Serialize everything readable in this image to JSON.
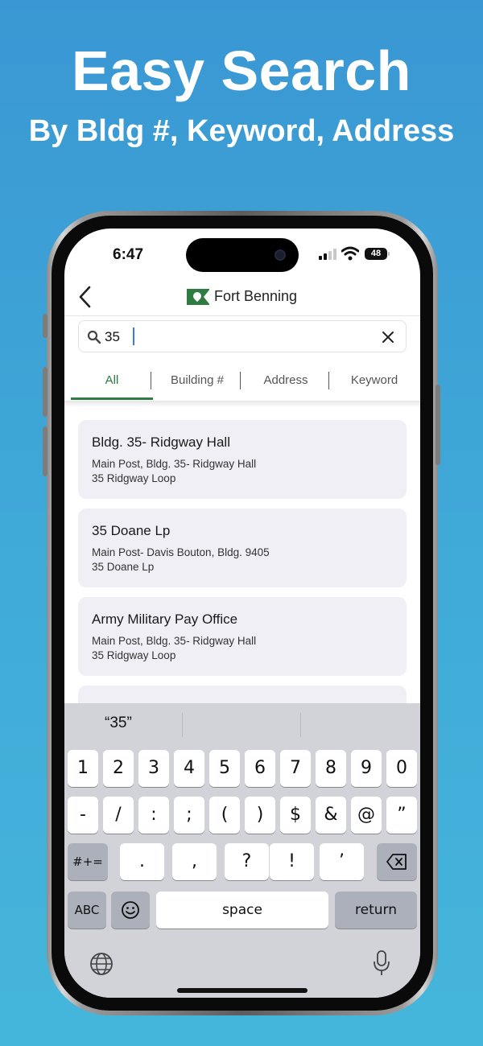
{
  "headline": {
    "title": "Easy Search",
    "subtitle": "By Bldg #, Keyword, Address"
  },
  "status_bar": {
    "time": "6:47",
    "battery": "48"
  },
  "nav": {
    "title": "Fort Benning"
  },
  "search": {
    "value": "35"
  },
  "tabs": [
    {
      "label": "All",
      "active": true
    },
    {
      "label": "Building #",
      "active": false
    },
    {
      "label": "Address",
      "active": false
    },
    {
      "label": "Keyword",
      "active": false
    }
  ],
  "results": [
    {
      "title": "Bldg. 35- Ridgway Hall",
      "line1": "Main Post, Bldg. 35- Ridgway Hall",
      "line2": "35 Ridgway Loop"
    },
    {
      "title": "35 Doane Lp",
      "line1": "Main Post- Davis Bouton, Bldg. 9405",
      "line2": "35 Doane Lp"
    },
    {
      "title": "Army Military Pay Office",
      "line1": "Main Post, Bldg. 35- Ridgway Hall",
      "line2": "35 Ridgway Loop"
    }
  ],
  "keyboard": {
    "suggestions": [
      "“35”",
      "",
      ""
    ],
    "row1": [
      "1",
      "2",
      "3",
      "4",
      "5",
      "6",
      "7",
      "8",
      "9",
      "0"
    ],
    "row2": [
      "-",
      "/",
      ":",
      ";",
      "(",
      ")",
      "$",
      "&",
      "@",
      "”"
    ],
    "row3_mode": "#+=",
    "row3": [
      ".",
      ",",
      "?",
      "!",
      "’"
    ],
    "abc": "ABC",
    "space": "space",
    "return": "return"
  },
  "colors": {
    "accent": "#2e7c42",
    "card_bg": "#f0eff5",
    "keyboard_bg": "#d1d3d9"
  }
}
